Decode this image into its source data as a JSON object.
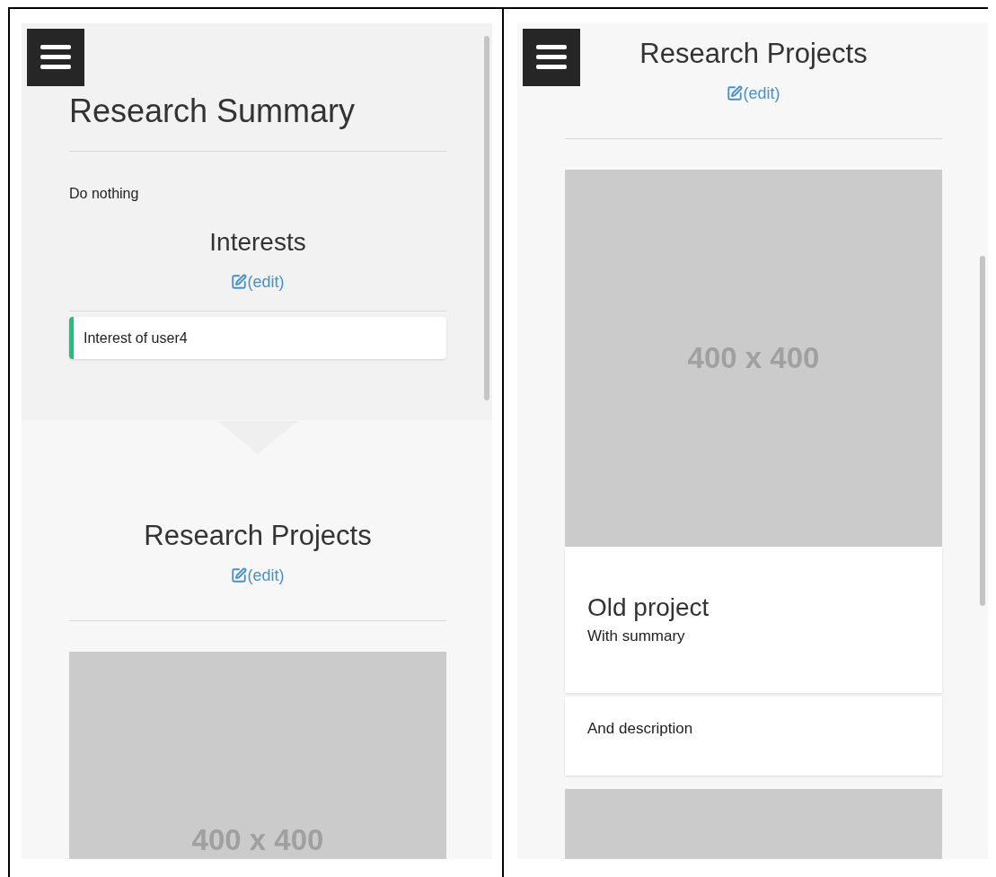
{
  "screens": [
    {
      "blocks": [
        {
          "kind": "heading",
          "text": "Research Summary"
        },
        {
          "kind": "text",
          "text": "Do nothing"
        },
        {
          "kind": "section",
          "title": "Interests",
          "edit": "(edit)"
        },
        {
          "kind": "interest",
          "text": "Interest of user4",
          "color": "#1ec17a"
        },
        {
          "kind": "section_end"
        },
        {
          "kind": "section",
          "title": "Research Projects",
          "edit": "(edit)"
        },
        {
          "kind": "image",
          "caption": "400 x 400"
        }
      ]
    },
    {
      "blocks": [
        {
          "kind": "section",
          "title": "Research Projects",
          "edit": "(edit)"
        },
        {
          "kind": "image",
          "caption": "400 x 400"
        },
        {
          "kind": "project",
          "title": "Old project",
          "summary": "With summary"
        },
        {
          "kind": "description",
          "text": "And description"
        },
        {
          "kind": "image"
        }
      ]
    }
  ]
}
